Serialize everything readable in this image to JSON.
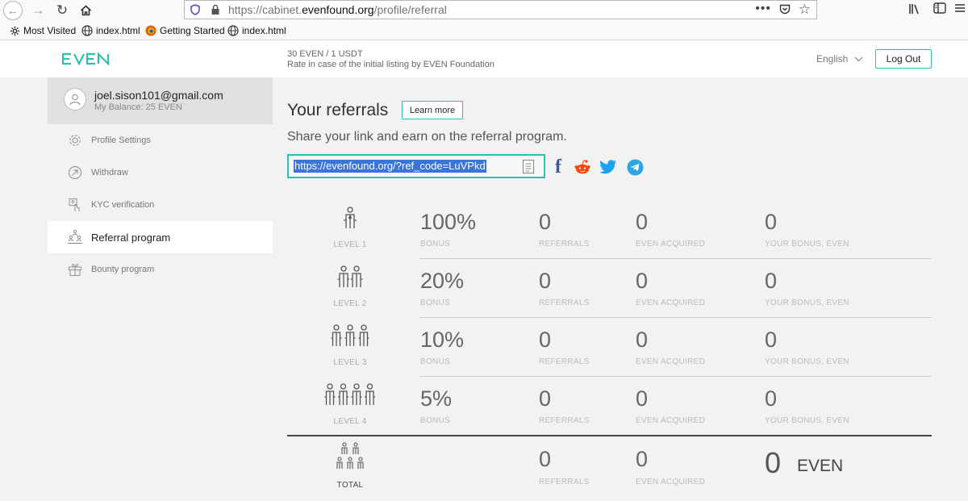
{
  "browser": {
    "url_prefix": "https://cabinet.",
    "url_host": "evenfound.org",
    "url_path": "/profile/referral",
    "url_dots": "•••",
    "bookmarks": [
      "Most Visited",
      "index.html",
      "Getting Started",
      "index.html"
    ]
  },
  "header": {
    "rate_main": "30 EVEN / 1 USDT",
    "rate_sub": "Rate in case of the initial listing by EVEN Foundation",
    "language": "English",
    "logout_label": "Log Out",
    "brand_color": "#2cc1ad"
  },
  "sidebar": {
    "email": "joel.sison101@gmail.com",
    "balance": "My Balance: 25 EVEN",
    "items": [
      {
        "label": "Profile Settings",
        "icon": "gear-icon"
      },
      {
        "label": "Withdraw",
        "icon": "withdraw-icon"
      },
      {
        "label": "KYC verification",
        "icon": "kyc-icon"
      },
      {
        "label": "Referral program",
        "icon": "referral-icon"
      },
      {
        "label": "Bounty program",
        "icon": "gift-icon"
      }
    ],
    "active": "Referral program"
  },
  "main": {
    "title": "Your referrals",
    "learn_more": "Learn more",
    "subtitle": "Share your link and earn on the referral program.",
    "ref_link": "https://evenfound.org/?ref_code=LuVPkd",
    "share_icons": [
      "facebook-icon",
      "reddit-icon",
      "twitter-icon",
      "telegram-icon"
    ]
  },
  "labels": {
    "bonus": "BONUS",
    "referrals": "REFERRALS",
    "even_acquired": "EVEN ACQUIRED",
    "your_bonus": "YOUR BONUS, EVEN"
  },
  "levels": [
    {
      "label": "LEVEL 1",
      "bonus": "100%",
      "referrals": "0",
      "even_acquired": "0",
      "your_bonus": "0"
    },
    {
      "label": "LEVEL 2",
      "bonus": "20%",
      "referrals": "0",
      "even_acquired": "0",
      "your_bonus": "0"
    },
    {
      "label": "LEVEL 3",
      "bonus": "10%",
      "referrals": "0",
      "even_acquired": "0",
      "your_bonus": "0"
    },
    {
      "label": "LEVEL 4",
      "bonus": "5%",
      "referrals": "0",
      "even_acquired": "0",
      "your_bonus": "0"
    }
  ],
  "total": {
    "label": "TOTAL",
    "referrals": "0",
    "even_acquired": "0",
    "bonus_value": "0",
    "bonus_unit": "EVEN"
  }
}
